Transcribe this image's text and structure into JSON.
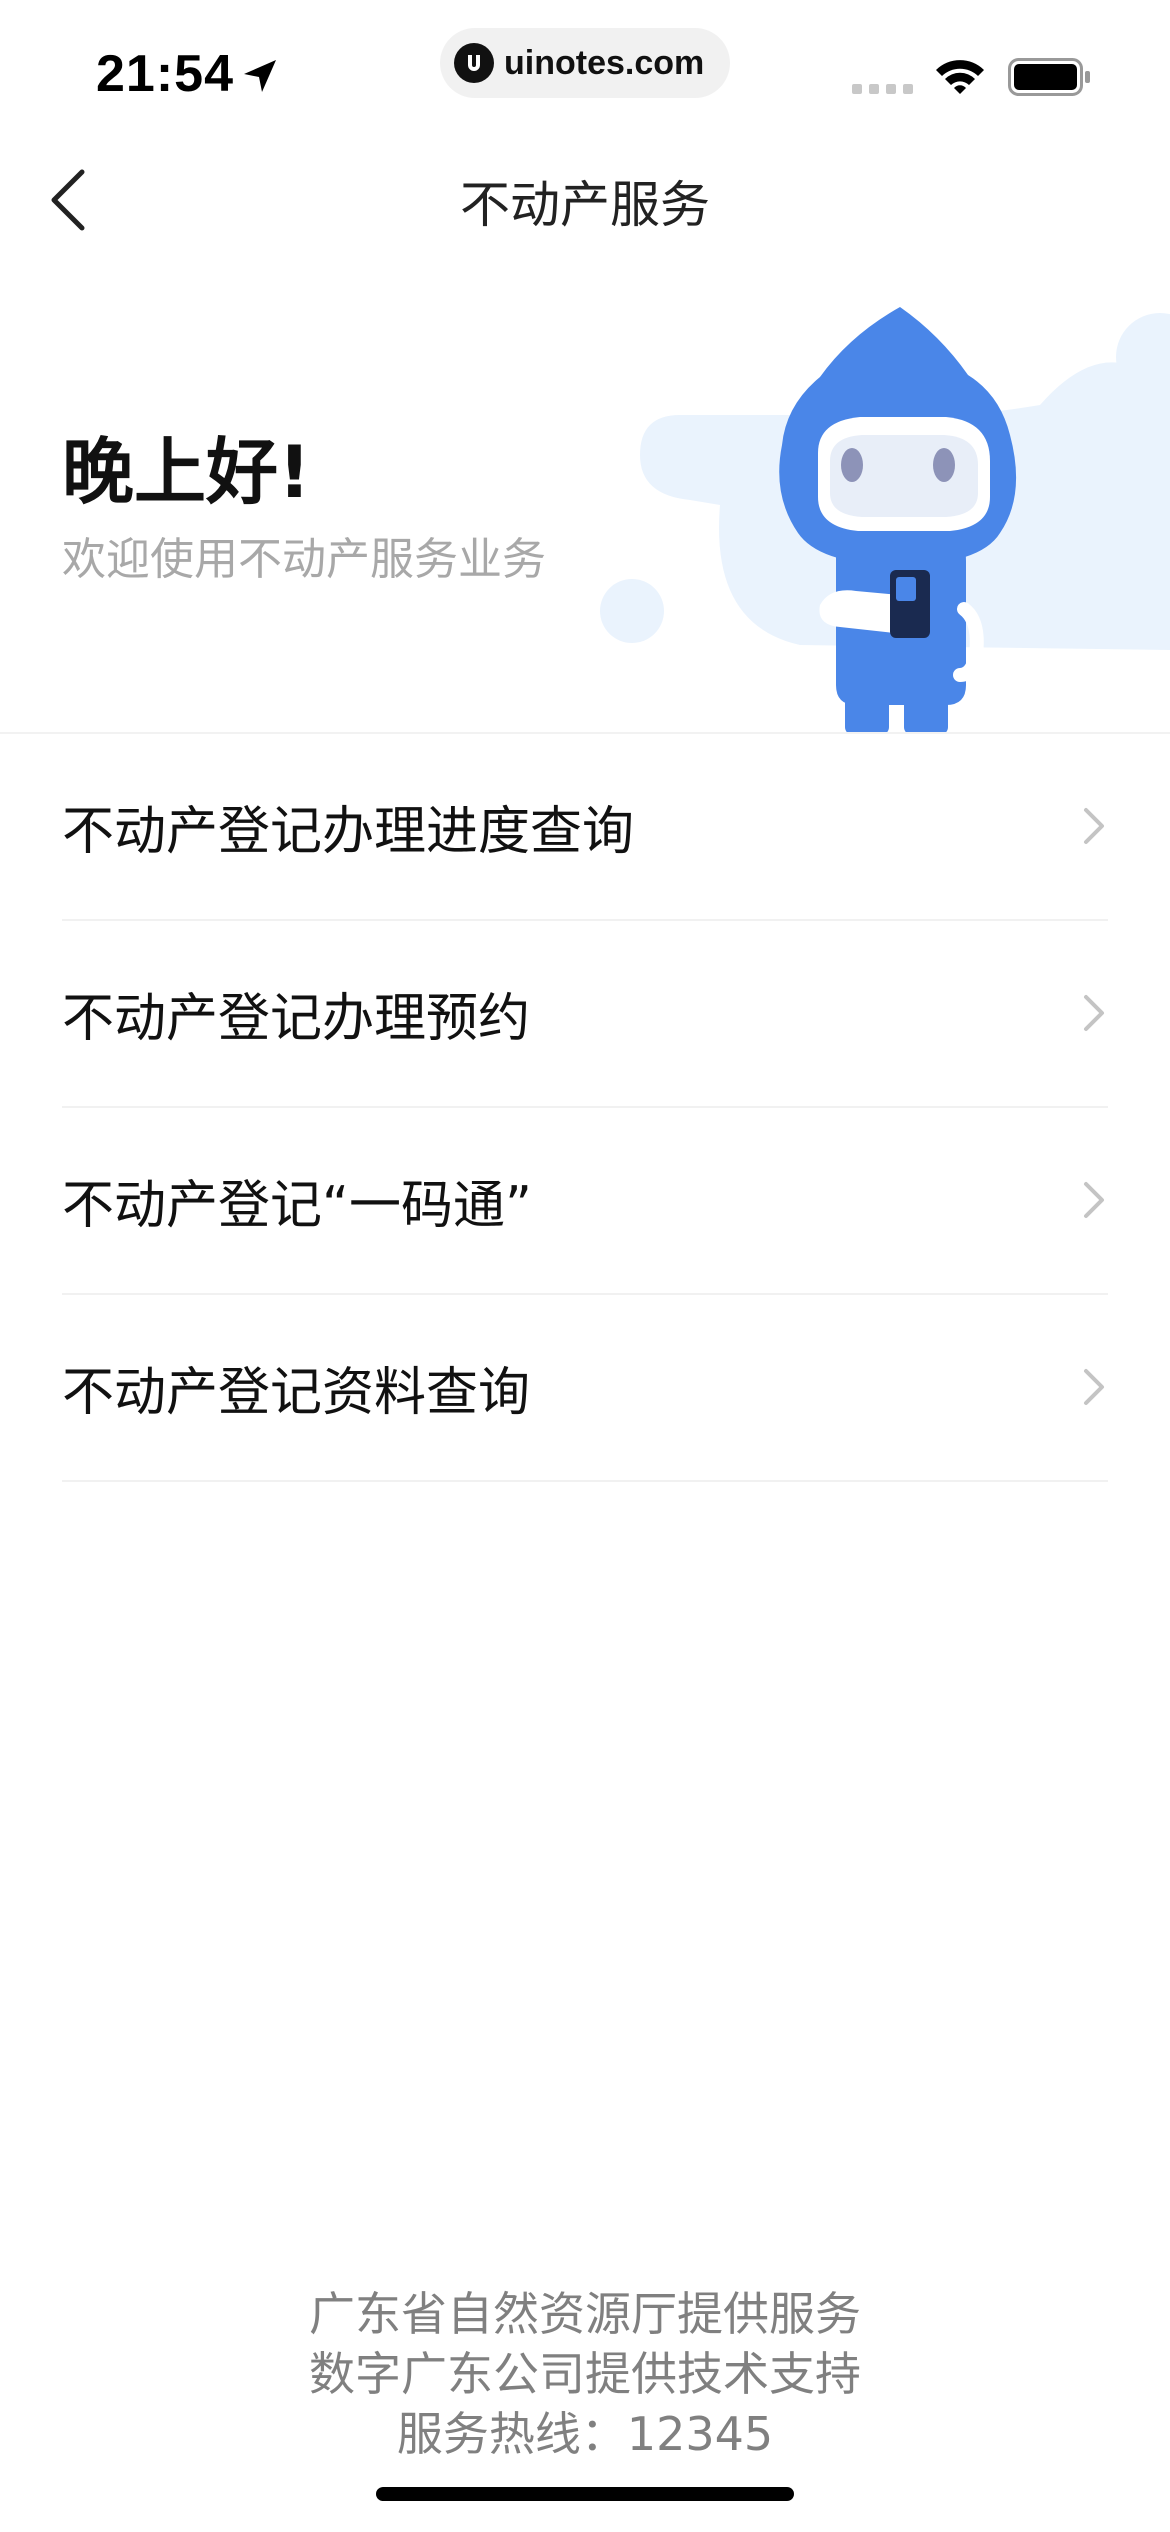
{
  "status_bar": {
    "time": "21:54",
    "url": "uinotes.com"
  },
  "nav": {
    "title": "不动产服务"
  },
  "banner": {
    "greeting": "晚上好!",
    "welcome": "欢迎使用不动产服务业务"
  },
  "menu": {
    "items": [
      {
        "label": "不动产登记办理进度查询"
      },
      {
        "label": "不动产登记办理预约"
      },
      {
        "label": "不动产登记“一码通”"
      },
      {
        "label": "不动产登记资料查询"
      }
    ]
  },
  "footer": {
    "line1": "广东省自然资源厅提供服务",
    "line2": "数字广东公司提供技术支持",
    "line3": "服务热线：12345"
  },
  "colors": {
    "accent_blue": "#4a86e8",
    "banner_bg": "#eaf3fd",
    "text_secondary": "#a8a8a8",
    "footer_text": "#808080"
  },
  "icons": [
    "location-arrow-icon",
    "uinotes-logo-icon",
    "cellular-signal-icon",
    "wifi-icon",
    "battery-icon",
    "back-arrow-icon",
    "chevron-right-icon",
    "mascot-illustration"
  ]
}
